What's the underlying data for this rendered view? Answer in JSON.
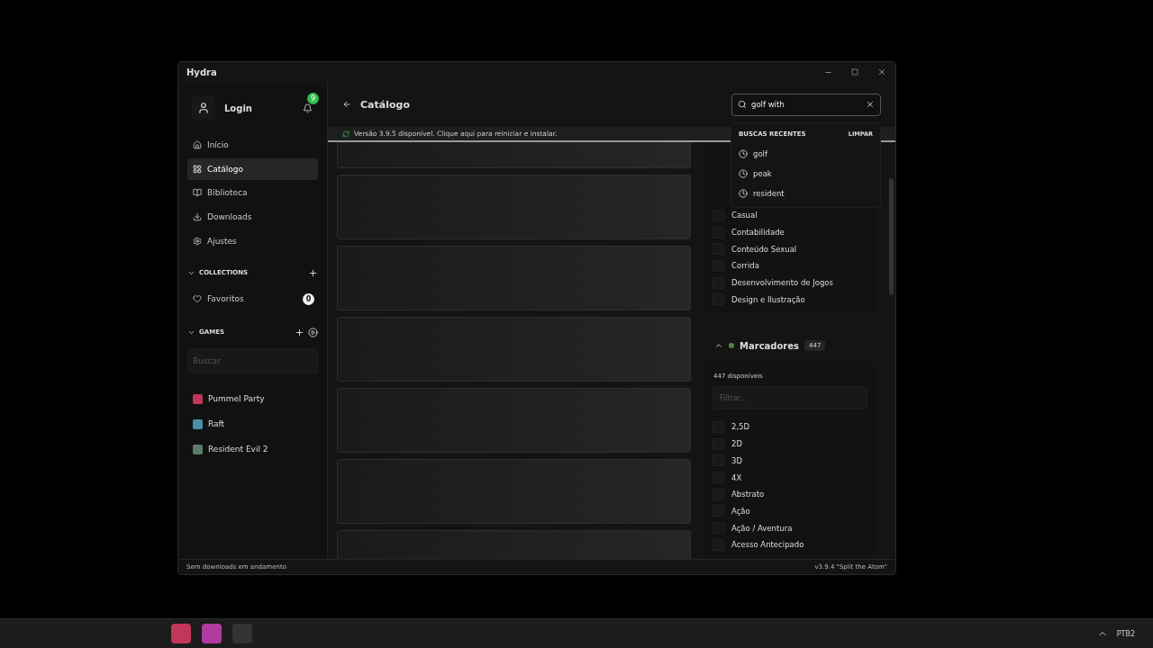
{
  "window": {
    "title": "Hydra"
  },
  "sidebar": {
    "login": "Login",
    "notifications_badge": "9",
    "nav": [
      {
        "label": "Início",
        "selected": false
      },
      {
        "label": "Catálogo",
        "selected": true
      },
      {
        "label": "Biblioteca",
        "selected": false
      },
      {
        "label": "Downloads",
        "selected": false
      },
      {
        "label": "Ajustes",
        "selected": false
      }
    ],
    "collections": {
      "title": "COLLECTIONS",
      "expanded": true,
      "items": [
        {
          "label": "Favoritos",
          "count": "0"
        }
      ]
    },
    "games": {
      "title": "GAMES",
      "expanded": true,
      "search_placeholder": "Buscar",
      "items": [
        {
          "label": "Pummel Party",
          "color": "#c2365a"
        },
        {
          "label": "Raft",
          "color": "#4a8fa8"
        },
        {
          "label": "Resident Evil 2",
          "color": "#5a7a6a"
        }
      ]
    }
  },
  "header": {
    "title": "Catálogo",
    "search": {
      "value": "golf with"
    }
  },
  "recent_searches": {
    "title": "BUSCAS RECENTES",
    "clear": "LIMPAR",
    "items": [
      "golf",
      "peak",
      "resident"
    ]
  },
  "update_banner": "Versão 3.9.5 disponível. Clique aqui para reiniciar e instalar.",
  "results": [
    {
      "kind": "placeholder"
    },
    {
      "kind": "placeholder"
    },
    {
      "kind": "placeholder"
    },
    {
      "kind": "placeholder"
    },
    {
      "kind": "placeholder"
    },
    {
      "kind": "placeholder"
    },
    {
      "kind": "placeholder"
    }
  ],
  "genres": {
    "items": [
      {
        "label": "Casual",
        "checked": false
      },
      {
        "label": "Contabilidade",
        "checked": false
      },
      {
        "label": "Conteúdo Sexual",
        "checked": false
      },
      {
        "label": "Corrida",
        "checked": false
      },
      {
        "label": "Desenvolvimento de Jogos",
        "checked": false
      },
      {
        "label": "Design e Ilustração",
        "checked": false
      }
    ]
  },
  "tags": {
    "title": "Marcadores",
    "count": "447",
    "expanded": true,
    "available": "447 disponíveis",
    "filter_placeholder": "Filtrar...",
    "items": [
      {
        "label": "2,5D",
        "checked": false
      },
      {
        "label": "2D",
        "checked": false
      },
      {
        "label": "3D",
        "checked": false
      },
      {
        "label": "4X",
        "checked": false
      },
      {
        "label": "Abstrato",
        "checked": false
      },
      {
        "label": "Ação",
        "checked": false
      },
      {
        "label": "Ação / Aventura",
        "checked": false
      },
      {
        "label": "Acesso Antecipado",
        "checked": false
      }
    ]
  },
  "status_bar": {
    "left": "Sem downloads em andamento",
    "right": "v3.9.4 \"Split the Atom\""
  },
  "taskbar": {
    "tray_label": "PTB2"
  }
}
